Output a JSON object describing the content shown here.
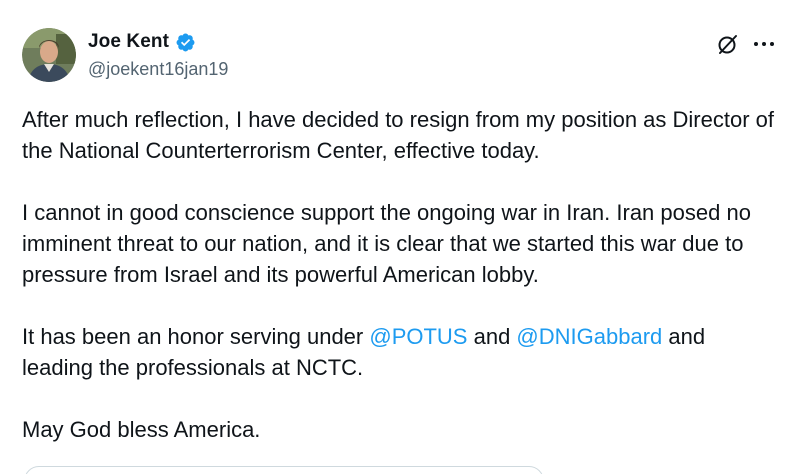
{
  "author": {
    "display_name": "Joe Kent",
    "handle": "@joekent16jan19",
    "verified_color": "#1d9bf0",
    "avatar_icon": "profile-photo"
  },
  "header_actions": {
    "grok_icon": "grok-icon",
    "more_icon": "more-dots-icon"
  },
  "tweet": {
    "p1": "After much reflection, I have decided to resign from my position as Director of the National Counterterrorism Center, effective today.",
    "p2": "I cannot in good conscience support the ongoing war in Iran. Iran posed no imminent threat to our nation, and it is clear that we started this war due to pressure from Israel and its powerful American lobby.",
    "p3_before": "It has been an honor serving under ",
    "mention1": "@POTUS",
    "p3_mid": " and ",
    "mention2": "@DNIGabbard",
    "p3_after": " and leading the professionals at NCTC.",
    "p4": "May God bless America."
  },
  "colors": {
    "text": "#0f1419",
    "secondary": "#536471",
    "link": "#1d9bf0",
    "border": "#cfd9de"
  }
}
